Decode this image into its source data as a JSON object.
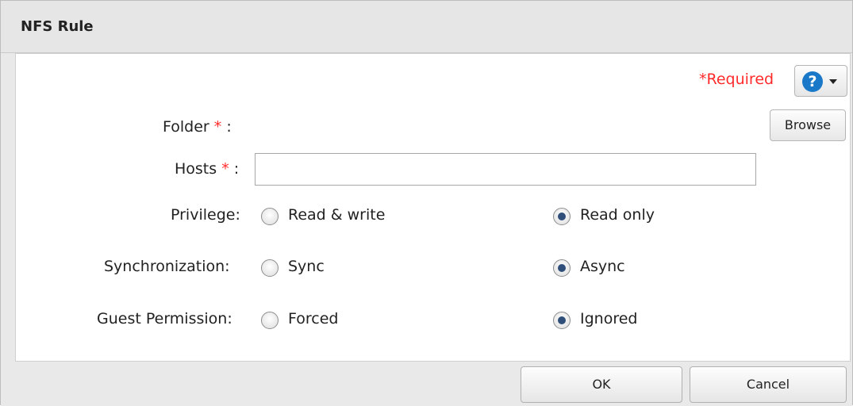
{
  "dialog": {
    "title": "NFS Rule"
  },
  "header": {
    "required_label": "*Required",
    "help_icon": "question-circle-icon",
    "help_glyph": "?"
  },
  "form": {
    "folder": {
      "label": "Folder",
      "required_mark": "*",
      "colon": " :",
      "browse_label": "Browse"
    },
    "hosts": {
      "label": "Hosts",
      "required_mark": "*",
      "colon": " :",
      "value": "",
      "placeholder": ""
    },
    "privilege": {
      "label": "Privilege:",
      "options": [
        "Read & write",
        "Read only"
      ],
      "selected": "Read only"
    },
    "synchronization": {
      "label": "Synchronization:",
      "options": [
        "Sync",
        "Async"
      ],
      "selected": "Async"
    },
    "guest_permission": {
      "label": "Guest Permission:",
      "options": [
        "Forced",
        "Ignored"
      ],
      "selected": "Ignored"
    }
  },
  "footer": {
    "ok_label": "OK",
    "cancel_label": "Cancel"
  },
  "colors": {
    "required_red": "#ff2b2b",
    "help_blue": "#1a78c8",
    "radio_dot": "#2f4f7a"
  }
}
